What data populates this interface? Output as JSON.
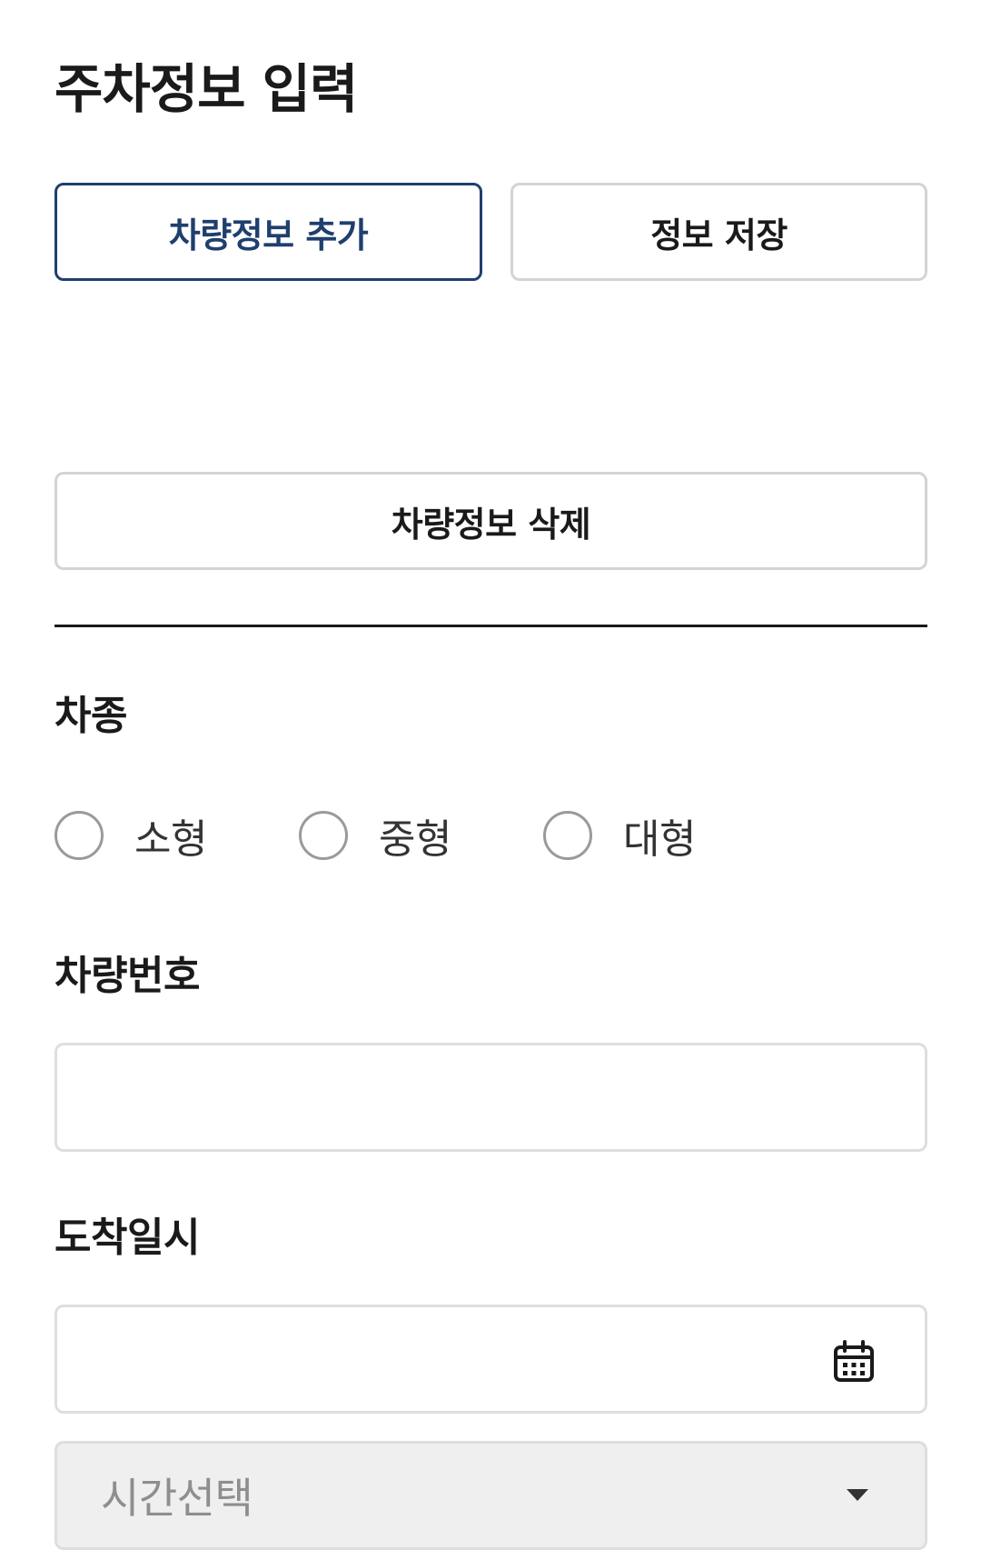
{
  "page": {
    "title": "주차정보 입력"
  },
  "actions": {
    "add_vehicle_label": "차량정보 추가",
    "save_label": "정보 저장",
    "delete_vehicle_label": "차량정보 삭제"
  },
  "vehicle_type": {
    "label": "차종",
    "options": [
      {
        "label": "소형",
        "selected": false
      },
      {
        "label": "중형",
        "selected": false
      },
      {
        "label": "대형",
        "selected": false
      }
    ]
  },
  "plate_number": {
    "label": "차량번호",
    "value": "",
    "placeholder": ""
  },
  "arrival": {
    "label": "도착일시",
    "date_value": "",
    "date_placeholder": "",
    "date_icon": "calendar-icon",
    "time_select": {
      "placeholder": "시간선택",
      "icon": "chevron-down-icon"
    }
  },
  "colors": {
    "accent": "#1f3f6e",
    "text": "#1a1a1a",
    "border": "#d4d4d4",
    "disabled_bg": "#efefef",
    "placeholder": "#8e8e8e"
  }
}
